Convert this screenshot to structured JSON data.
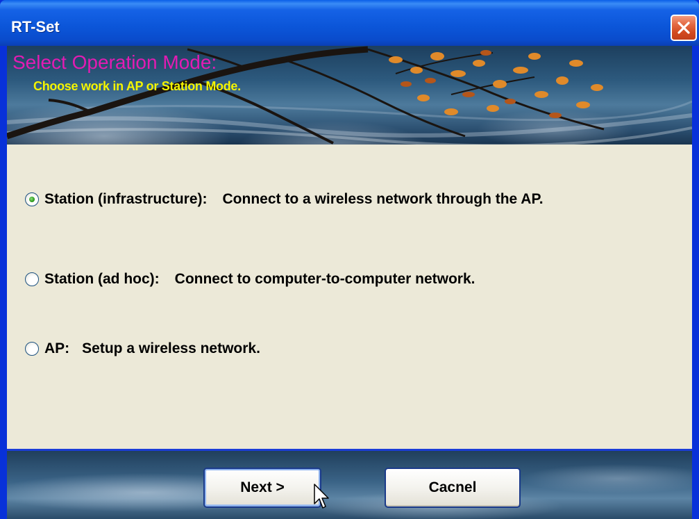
{
  "window": {
    "title": "RT-Set"
  },
  "banner": {
    "title": "Select Operation Mode:",
    "subtitle": "Choose work in AP or Station Mode."
  },
  "options": [
    {
      "label": "Station (infrastructure):",
      "description": "Connect to a wireless network through the AP.",
      "checked": true
    },
    {
      "label": "Station (ad hoc):",
      "description": "Connect to computer-to-computer network.",
      "checked": false
    },
    {
      "label": "AP:",
      "description": "Setup a wireless network.",
      "checked": false
    }
  ],
  "buttons": {
    "next": "Next >",
    "cancel": "Cacnel"
  },
  "colors": {
    "titlebar": "#0b55d8",
    "banner_title": "#e21cb3",
    "banner_subtitle": "#f4f400",
    "content_bg": "#ece9d8",
    "close": "#d24a1f"
  },
  "icons": {
    "close": "close-icon",
    "cursor": "mouse-pointer-icon"
  }
}
